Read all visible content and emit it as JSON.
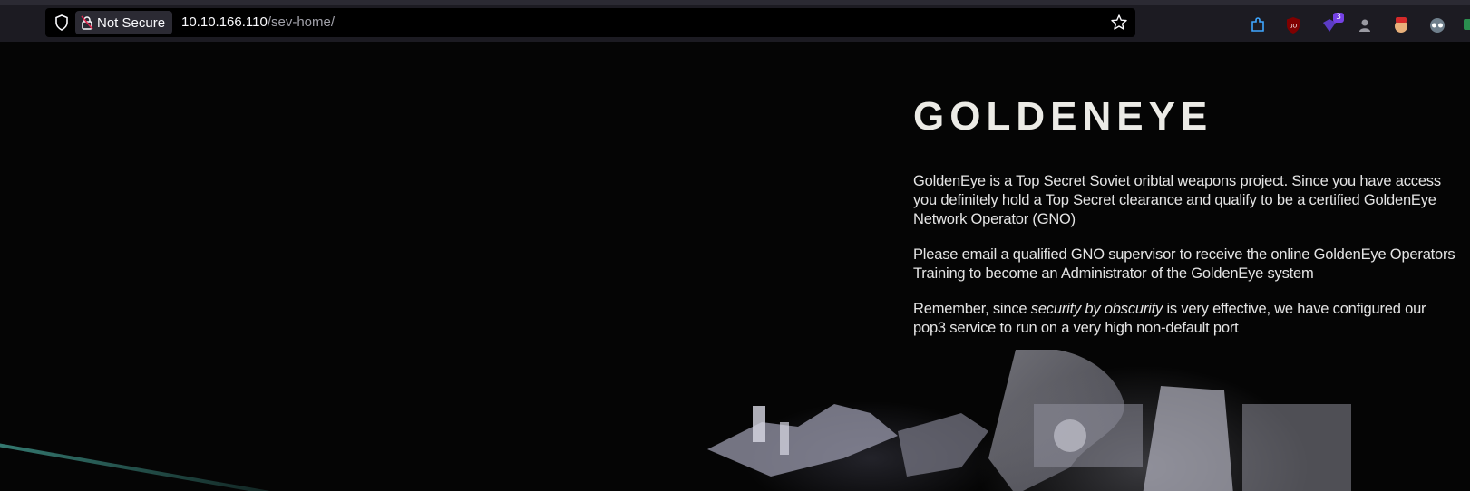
{
  "browser": {
    "security_label": "Not Secure",
    "url_host": "10.10.166.110",
    "url_path": "/sev-home/",
    "extensions": [
      {
        "name": "extension-puzzle-icon",
        "badge": ""
      },
      {
        "name": "ublock-icon",
        "badge": ""
      },
      {
        "name": "extension-purple-icon",
        "badge": "3"
      },
      {
        "name": "extension-mask-icon",
        "badge": ""
      },
      {
        "name": "extension-avatar-icon",
        "badge": ""
      },
      {
        "name": "extension-spy-icon",
        "badge": ""
      }
    ]
  },
  "page": {
    "title": "GOLDENEYE",
    "paragraph1": "GoldenEye is a Top Secret Soviet oribtal weapons project. Since you have access you definitely hold a Top Secret clearance and qualify to be a certified GoldenEye Network Operator (GNO)",
    "paragraph2": "Please email a qualified GNO supervisor to receive the online GoldenEye Operators Training to become an Administrator of the GoldenEye system",
    "paragraph3_before": "Remember, since ",
    "paragraph3_emphasis": "security by obscurity",
    "paragraph3_after": " is very effective, we have configured our pop3 service to run on a very high non-default port"
  }
}
